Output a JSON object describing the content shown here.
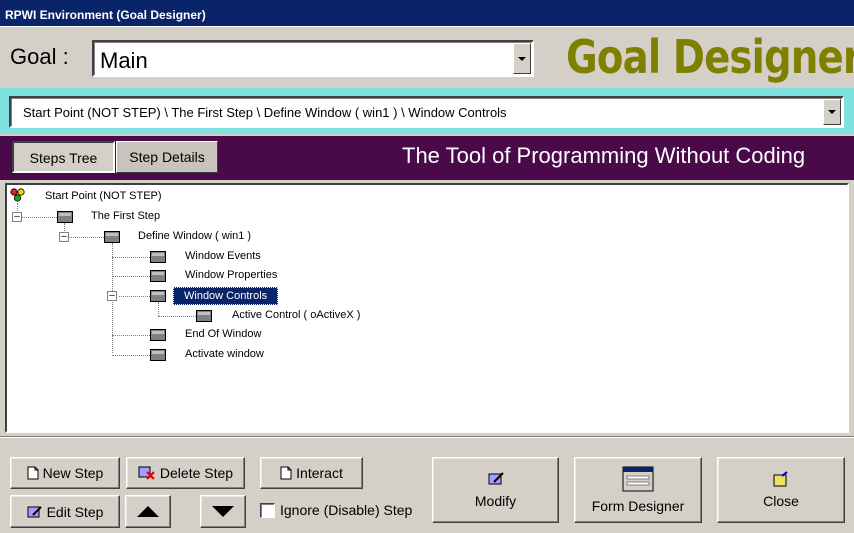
{
  "window": {
    "title": "RPWI Environment (Goal Designer)"
  },
  "goal": {
    "label": "Goal :",
    "value": "Main"
  },
  "brand": {
    "title": "Goal Designer",
    "tagline": "The Tool of Programming Without Coding"
  },
  "path": {
    "value": "Start Point (NOT STEP) \\ The First Step \\ Define Window  ( win1 ) \\ Window Controls"
  },
  "tabs": [
    {
      "label": "Steps Tree"
    },
    {
      "label": "Step Details"
    }
  ],
  "tree": {
    "nodes": [
      {
        "label": "Start Point (NOT STEP)"
      },
      {
        "label": "The First Step"
      },
      {
        "label": "Define Window   ( win1 )"
      },
      {
        "label": "Window Events"
      },
      {
        "label": "Window Properties"
      },
      {
        "label": "Window Controls"
      },
      {
        "label": "Active Control ( oActiveX )"
      },
      {
        "label": "End Of Window"
      },
      {
        "label": "Activate window"
      }
    ]
  },
  "buttons": {
    "new_step": "New Step",
    "delete_step": "Delete Step",
    "interact": "Interact",
    "edit_step": "Edit Step",
    "ignore_step": "Ignore (Disable) Step",
    "modify": "Modify",
    "form_designer": "Form Designer",
    "close": "Close"
  },
  "colors": {
    "titlebar": "#0a246a",
    "brand": "#808000",
    "path_bar": "#7fe0e0",
    "tab_bar": "#4a0a4a",
    "selection": "#0a246a"
  }
}
